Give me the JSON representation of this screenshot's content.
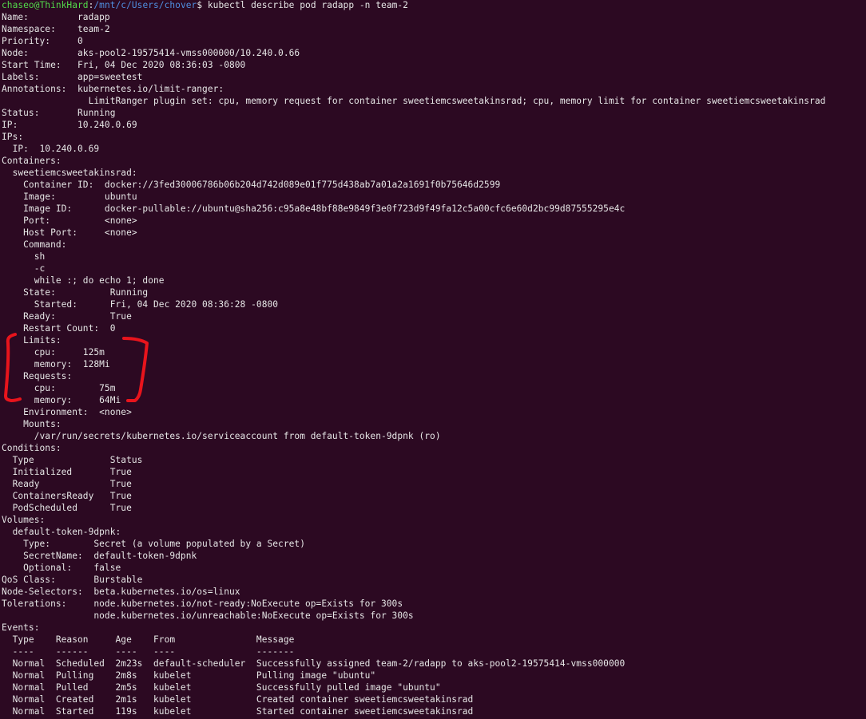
{
  "terminal": {
    "prompt": {
      "user_host": "chaseo@ThinkHard",
      "separator": ":",
      "path": "/mnt/c/Users/chover",
      "symbol": "$",
      "command": " kubectl describe pod radapp -n team-2"
    },
    "lines": [
      "Name:         radapp",
      "Namespace:    team-2",
      "Priority:     0",
      "Node:         aks-pool2-19575414-vmss000000/10.240.0.66",
      "Start Time:   Fri, 04 Dec 2020 08:36:03 -0800",
      "Labels:       app=sweetest",
      "Annotations:  kubernetes.io/limit-ranger:",
      "                LimitRanger plugin set: cpu, memory request for container sweetiemcsweetakinsrad; cpu, memory limit for container sweetiemcsweetakinsrad",
      "Status:       Running",
      "IP:           10.240.0.69",
      "IPs:",
      "  IP:  10.240.0.69",
      "Containers:",
      "  sweetiemcsweetakinsrad:",
      "    Container ID:  docker://3fed30006786b06b204d742d089e01f775d438ab7a01a2a1691f0b75646d2599",
      "    Image:         ubuntu",
      "    Image ID:      docker-pullable://ubuntu@sha256:c95a8e48bf88e9849f3e0f723d9f49fa12c5a00cfc6e60d2bc99d87555295e4c",
      "    Port:          <none>",
      "    Host Port:     <none>",
      "    Command:",
      "      sh",
      "      -c",
      "      while :; do echo 1; done",
      "    State:          Running",
      "      Started:      Fri, 04 Dec 2020 08:36:28 -0800",
      "    Ready:          True",
      "    Restart Count:  0",
      "    Limits:",
      "      cpu:     125m",
      "      memory:  128Mi",
      "    Requests:",
      "      cpu:        75m",
      "      memory:     64Mi",
      "    Environment:  <none>",
      "    Mounts:",
      "      /var/run/secrets/kubernetes.io/serviceaccount from default-token-9dpnk (ro)",
      "Conditions:",
      "  Type              Status",
      "  Initialized       True",
      "  Ready             True",
      "  ContainersReady   True",
      "  PodScheduled      True",
      "Volumes:",
      "  default-token-9dpnk:",
      "    Type:        Secret (a volume populated by a Secret)",
      "    SecretName:  default-token-9dpnk",
      "    Optional:    false",
      "QoS Class:       Burstable",
      "Node-Selectors:  beta.kubernetes.io/os=linux",
      "Tolerations:     node.kubernetes.io/not-ready:NoExecute op=Exists for 300s",
      "                 node.kubernetes.io/unreachable:NoExecute op=Exists for 300s",
      "Events:",
      "  Type    Reason     Age    From               Message",
      "  ----    ------     ----   ----               -------",
      "  Normal  Scheduled  2m23s  default-scheduler  Successfully assigned team-2/radapp to aks-pool2-19575414-vmss000000",
      "  Normal  Pulling    2m8s   kubelet            Pulling image \"ubuntu\"",
      "  Normal  Pulled     2m5s   kubelet            Successfully pulled image \"ubuntu\"",
      "  Normal  Created    2m1s   kubelet            Created container sweetiemcsweetakinsrad",
      "  Normal  Started    119s   kubelet            Started container sweetiemcsweetakinsrad"
    ]
  },
  "colors": {
    "background": "#2c0922",
    "text": "#e6e6e6",
    "prompt_user": "#52d94a",
    "prompt_path": "#4f8fe0",
    "annotation": "#e8141c"
  }
}
